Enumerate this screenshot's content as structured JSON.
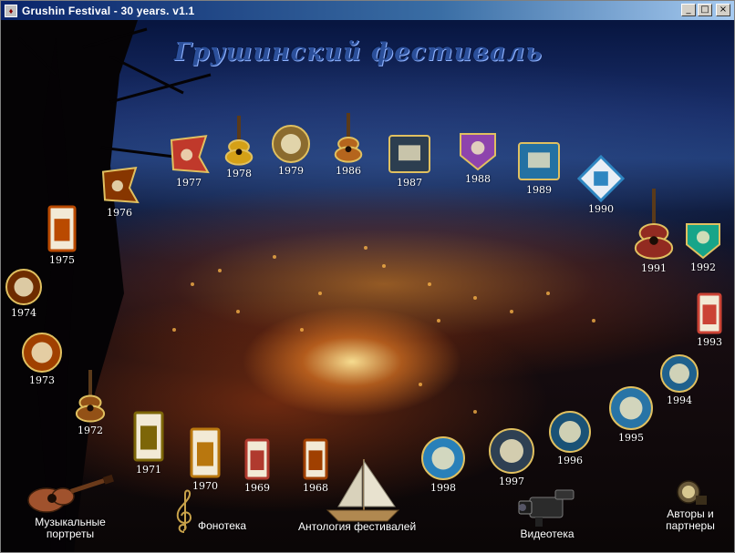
{
  "window": {
    "title": "Grushin Festival - 30 years. v1.1",
    "controls": {
      "minimize": "_",
      "maximize": "□",
      "close": "×"
    }
  },
  "heading": "Грушинский фестиваль",
  "badges": [
    {
      "year": "1977",
      "color": "#c0392b"
    },
    {
      "year": "1978",
      "color": "#d4a017"
    },
    {
      "year": "1979",
      "color": "#8b6b2e"
    },
    {
      "year": "1986",
      "color": "#b5651d"
    },
    {
      "year": "1987",
      "color": "#2c3e50"
    },
    {
      "year": "1988",
      "color": "#8e44ad"
    },
    {
      "year": "1989",
      "color": "#2471a3"
    },
    {
      "year": "1990",
      "color": "#2e86c1"
    },
    {
      "year": "1991",
      "color": "#922b21"
    },
    {
      "year": "1992",
      "color": "#17a589"
    },
    {
      "year": "1993",
      "color": "#cb4335"
    },
    {
      "year": "1994",
      "color": "#1f618d"
    },
    {
      "year": "1995",
      "color": "#2874a6"
    },
    {
      "year": "1996",
      "color": "#1a5276"
    },
    {
      "year": "1997",
      "color": "#2e4053"
    },
    {
      "year": "1998",
      "color": "#2980b9"
    },
    {
      "year": "1968",
      "color": "#a04000"
    },
    {
      "year": "1969",
      "color": "#b03a2e"
    },
    {
      "year": "1970",
      "color": "#b9770e"
    },
    {
      "year": "1971",
      "color": "#7d6608"
    },
    {
      "year": "1972",
      "color": "#935116"
    },
    {
      "year": "1973",
      "color": "#a04000"
    },
    {
      "year": "1974",
      "color": "#6e2c00"
    },
    {
      "year": "1975",
      "color": "#ba4a00"
    },
    {
      "year": "1976",
      "color": "#873600"
    }
  ],
  "nav": {
    "portraits": "Музыкальные портреты",
    "phonotheque": "Фонотека",
    "anthology": "Антология фестивалей",
    "videotheque": "Видеотека",
    "authors": "Авторы и партнеры"
  }
}
